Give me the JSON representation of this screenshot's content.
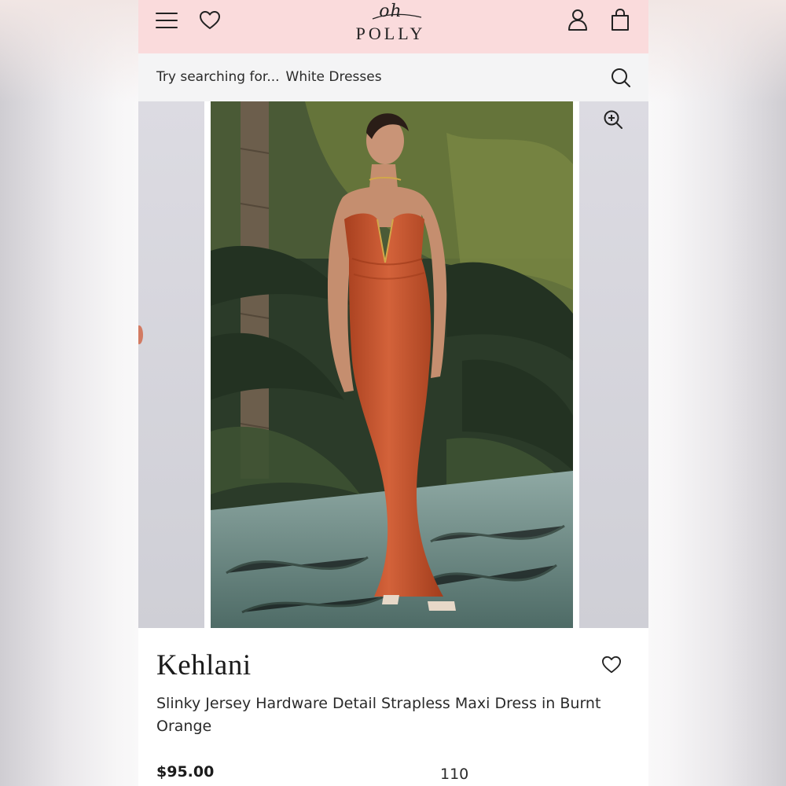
{
  "header": {
    "logo_script": "oh",
    "logo_text": "POLLY",
    "icons": [
      "menu-icon",
      "heart-icon",
      "account-icon",
      "bag-icon"
    ]
  },
  "search": {
    "prompt": "Try searching for...",
    "suggestion": "White Dresses",
    "icon": "search-icon"
  },
  "product": {
    "name": "Kehlani",
    "description": "Slinky Jersey Hardware Detail Strapless Maxi Dress in Burnt Orange",
    "price": "$95.00",
    "count": "110"
  },
  "colors": {
    "header_bg": "#fadbdc",
    "search_bg": "#f4f4f5",
    "dress": "#c9532f",
    "text": "#1b1b1b"
  }
}
